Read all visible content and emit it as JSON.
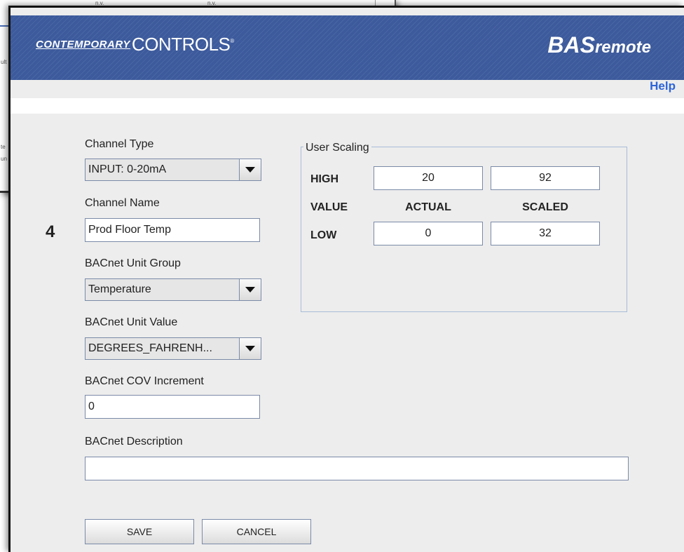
{
  "background_window": {
    "fragments": [
      "n.v.",
      "n.v.",
      "ult",
      "te",
      "un"
    ]
  },
  "header": {
    "brand_left": "CONTEMPORARY",
    "brand_right": "ONTROLS",
    "brand_mark": "C",
    "trademark": "®",
    "product_bold": "BAS",
    "product_rest": "remote",
    "help_link": "Help"
  },
  "channel": {
    "number": "4"
  },
  "form": {
    "channel_type": {
      "label": "Channel Type",
      "value": "INPUT: 0-20mA"
    },
    "channel_name": {
      "label": "Channel Name",
      "value": "Prod Floor Temp"
    },
    "unit_group": {
      "label": "BACnet Unit Group",
      "value": "Temperature"
    },
    "unit_value": {
      "label": "BACnet Unit Value",
      "value": "DEGREES_FAHRENH..."
    },
    "cov_increment": {
      "label": "BACnet COV Increment",
      "value": "0"
    },
    "description": {
      "label": "BACnet Description",
      "value": ""
    }
  },
  "user_scaling": {
    "title": "User Scaling",
    "row_high": "HIGH",
    "row_value": "VALUE",
    "row_low": "LOW",
    "col_actual": "ACTUAL",
    "col_scaled": "SCALED",
    "high_actual": "20",
    "high_scaled": "92",
    "low_actual": "0",
    "low_scaled": "32"
  },
  "buttons": {
    "save": "SAVE",
    "cancel": "CANCEL"
  },
  "colors": {
    "banner": "#3c5a9c",
    "help": "#2d64d8",
    "panel": "#ededed"
  },
  "icons": {
    "dropdown": "chevron-down-icon"
  }
}
